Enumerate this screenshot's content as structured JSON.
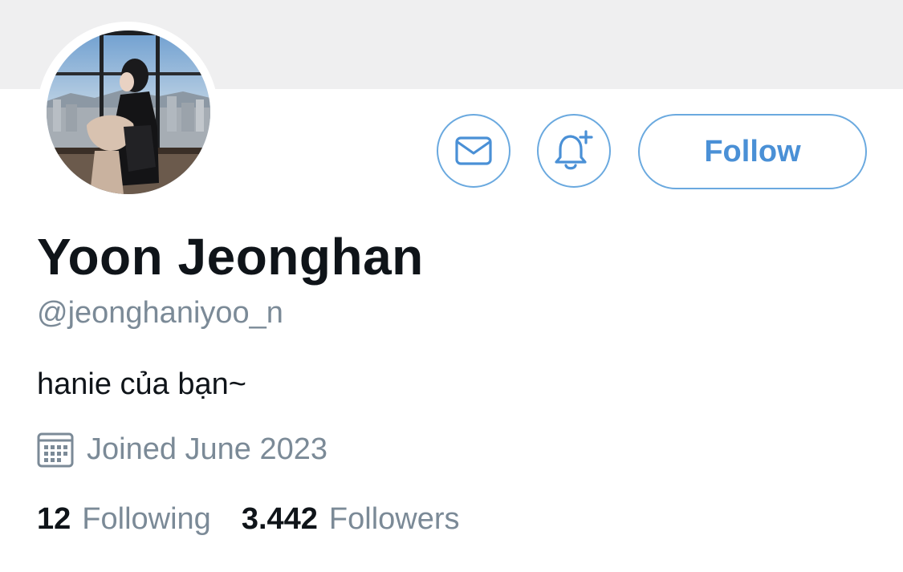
{
  "profile": {
    "display_name": "Yoon Jeonghan",
    "handle": "@jeonghaniyoo_n",
    "bio": "hanie của bạn~",
    "joined": "Joined June 2023",
    "following_count": "12",
    "following_label": "Following",
    "followers_count": "3.442",
    "followers_label": "Followers"
  },
  "actions": {
    "message_icon": "mail-icon",
    "notify_icon": "bell-plus-icon",
    "follow_label": "Follow"
  },
  "icons": {
    "calendar": "calendar-icon"
  },
  "colors": {
    "accent": "#4a90d6",
    "accent_border": "#6aa9df",
    "muted_text": "#7b8a97",
    "banner": "#efeff0",
    "text": "#0f1419"
  }
}
